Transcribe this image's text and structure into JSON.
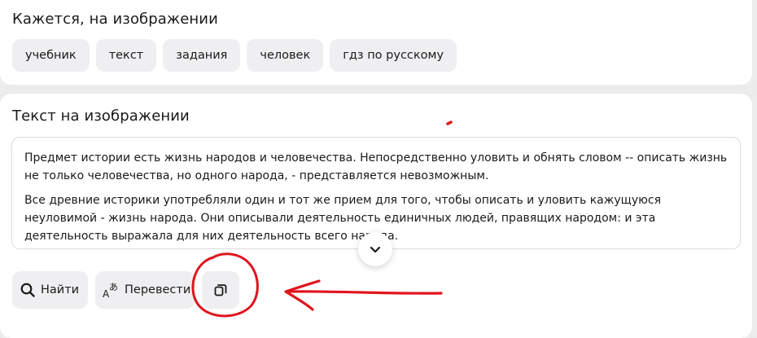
{
  "tags_section": {
    "title": "Кажется, на изображении",
    "tags": [
      "учебник",
      "текст",
      "задания",
      "человек",
      "гдз по русскому"
    ]
  },
  "text_section": {
    "title": "Текст на изображении",
    "paragraphs": [
      "Предмет истории есть жизнь народов и человечества. Непосредственно уловить и обнять словом -- описать жизнь не только человечества, но одного народа, - представляется невозможным.",
      "Все древние историки употребляли один и тот же прием для того, чтобы описать и уловить кажущуюся неуловимой - жизнь народа. Они описывали деятельность единичных людей, правящих народом: и эта деятельность выражала для них деятельность всего народа."
    ]
  },
  "actions": {
    "find_label": "Найти",
    "translate_label": "Перевести"
  },
  "icons": {
    "expand": "chevron-down-icon",
    "find": "search-icon",
    "translate": "translate-icon",
    "copy": "copy-icon"
  },
  "annotation": {
    "color": "#e0141e"
  }
}
